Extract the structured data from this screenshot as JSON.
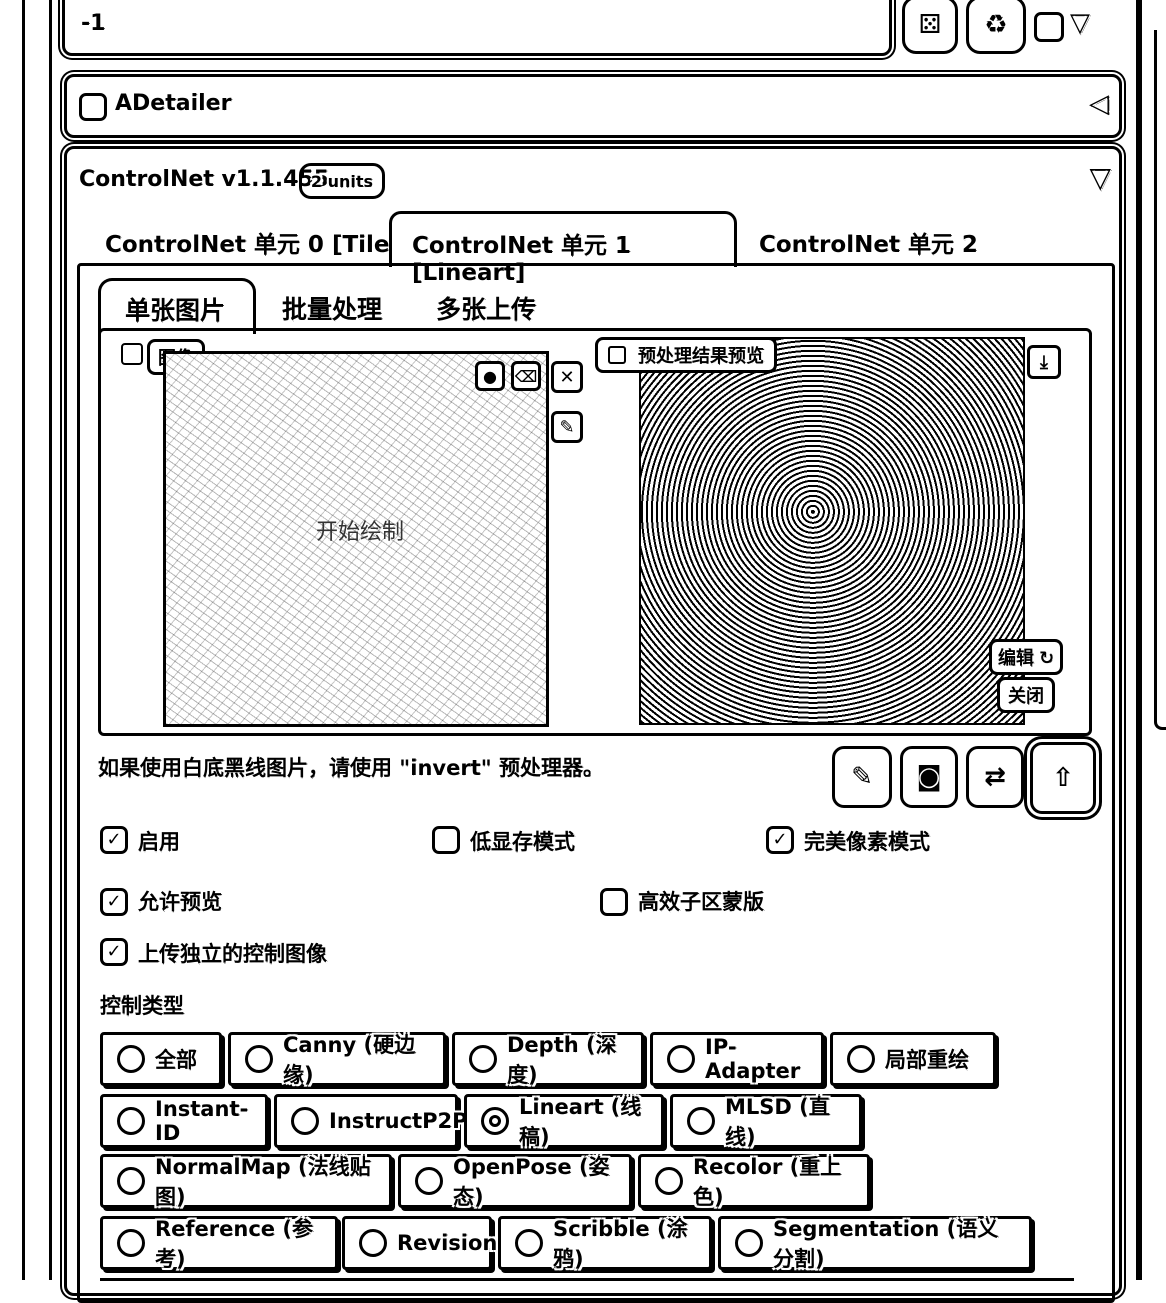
{
  "seed": {
    "value": "-1"
  },
  "adetailer": {
    "label": "ADetailer",
    "checked": false
  },
  "controlnet": {
    "title": "ControlNet v1.1.455",
    "badge": "2 units",
    "unit_tabs": [
      "ControlNet 单元 0 [Tile]",
      "ControlNet 单元 1 [Lineart]",
      "ControlNet 单元 2"
    ],
    "active_unit": 1,
    "image_tabs": [
      "单张图片",
      "批量处理",
      "多张上传"
    ],
    "active_image_tab": 0,
    "image_label": "图像",
    "image_overlay_text": "开始绘制",
    "preview_label": "预处理结果预览",
    "preview_buttons": {
      "edit": "编辑",
      "close": "关闭"
    },
    "hint": "如果使用白底黑线图片，请使用 \"invert\" 预处理器。",
    "options": {
      "enable": {
        "label": "启用",
        "checked": true
      },
      "lowvram": {
        "label": "低显存模式",
        "checked": false
      },
      "pixel_perfect": {
        "label": "完美像素模式",
        "checked": true
      },
      "allow_preview": {
        "label": "允许预览",
        "checked": true
      },
      "effective_region_mask": {
        "label": "高效子区蒙版",
        "checked": false
      },
      "upload_independent": {
        "label": "上传独立的控制图像",
        "checked": true
      }
    },
    "control_type_label": "控制类型",
    "control_types": [
      [
        "全部",
        "Canny (硬边缘)",
        "Depth (深度)",
        "IP-Adapter",
        "局部重绘"
      ],
      [
        "Instant-ID",
        "InstructP2P",
        "Lineart (线稿)",
        "MLSD (直线)"
      ],
      [
        "NormalMap (法线贴图)",
        "OpenPose (姿态)",
        "Recolor (重上色)"
      ],
      [
        "Reference (参考)",
        "Revision",
        "Scribble (涂鸦)",
        "Segmentation (语义分割)"
      ]
    ],
    "selected_control_type": "Lineart (线稿)"
  }
}
